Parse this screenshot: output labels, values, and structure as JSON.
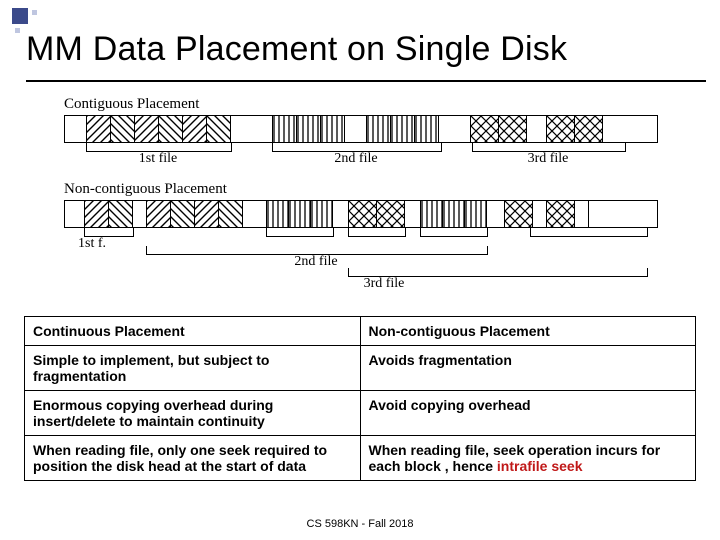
{
  "title": "MM Data Placement on Single Disk",
  "diagram": {
    "contiguous_label": "Contiguous Placement",
    "noncontig_label": "Non-contiguous Placement",
    "file1": "1st file",
    "file2": "2nd file",
    "file3": "3rd file",
    "file1_short": "1st f."
  },
  "table": {
    "headers": {
      "left": "Continuous Placement",
      "right": "Non-contiguous Placement"
    },
    "rows": [
      {
        "left": "Simple to implement, but subject to fragmentation",
        "right": "Avoids fragmentation"
      },
      {
        "left": "Enormous copying overhead during insert/delete to maintain continuity",
        "right": "Avoid copying overhead"
      },
      {
        "left": "When reading file, only one seek required to position the disk head at the start of data",
        "right_pre": "When reading file, seek operation incurs for each block , hence ",
        "right_hilite": "intrafile seek"
      }
    ]
  },
  "footer": "CS 598KN - Fall 2018"
}
